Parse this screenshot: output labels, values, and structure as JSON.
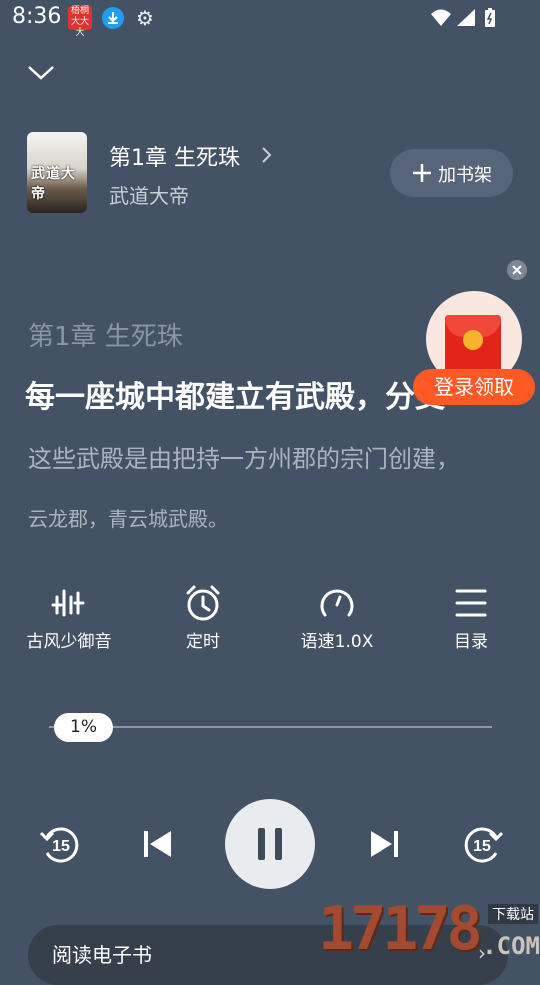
{
  "status_bar": {
    "time": "8:36",
    "app_badge_text": "梧桐 大大大"
  },
  "book": {
    "cover_text": "武道大帝",
    "chapter_title": "第1章 生死珠",
    "book_name": "武道大帝",
    "add_shelf_label": "加书架"
  },
  "reading": {
    "chapter_line": "第1章 生死珠",
    "current_line": "每一座城中都建立有武殿，分支",
    "next_line": "这些武殿是由把持一方州郡的宗门创建，",
    "next_line2": "云龙郡，青云城武殿。"
  },
  "promo": {
    "label": "登录领取"
  },
  "controls": [
    {
      "label": "古风少御音",
      "icon": "voice-equalizer-icon"
    },
    {
      "label": "定时",
      "icon": "alarm-clock-icon"
    },
    {
      "label": "语速1.0X",
      "icon": "speed-gauge-icon"
    },
    {
      "label": "目录",
      "icon": "menu-list-icon"
    }
  ],
  "progress": {
    "value_text": "1%",
    "fraction": 0.01
  },
  "playback": {
    "rewind_seconds": "15",
    "forward_seconds": "15"
  },
  "bottom_bar": {
    "read_ebook_label": "阅读电子书"
  },
  "watermark": {
    "numbers": "17178",
    "tag": "下载站",
    "suffix": ".COM"
  },
  "colors": {
    "background": "#435365",
    "promo_orange": "#ff5a25",
    "envelope_red": "#e2241b"
  }
}
